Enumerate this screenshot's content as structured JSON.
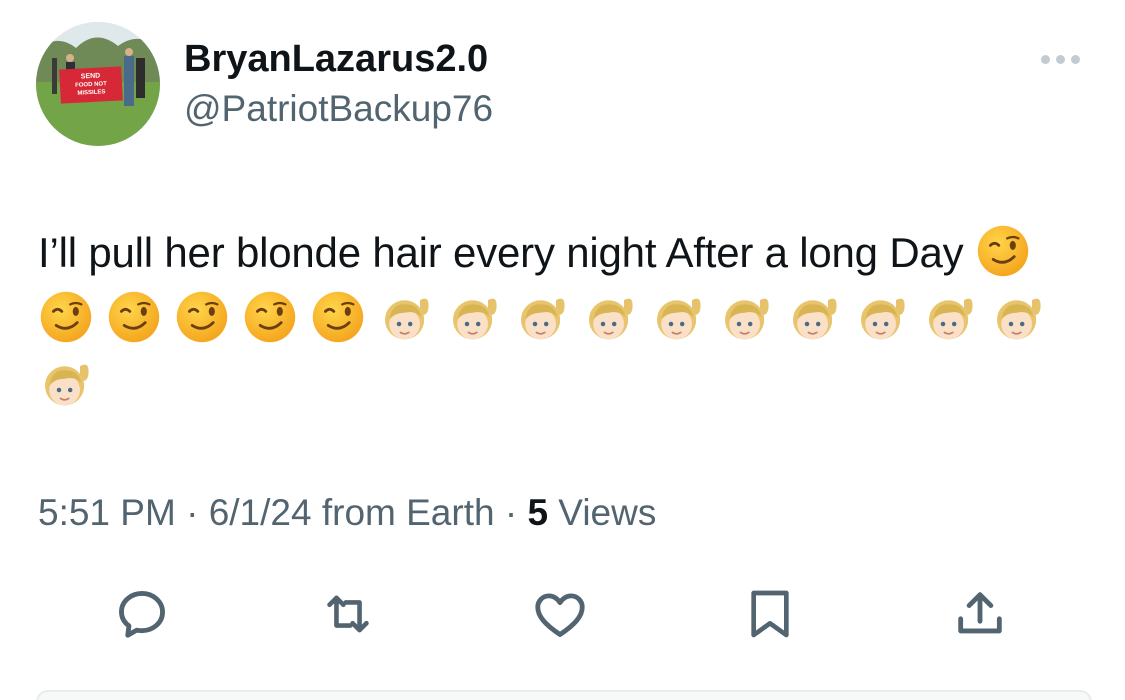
{
  "author": {
    "display_name": "BryanLazarus2.0",
    "handle": "@PatriotBackup76",
    "avatar_sign_text": [
      "SEND",
      "FOOD NOT",
      "MISSILES"
    ]
  },
  "more_menu": {
    "icon": "more-horizontal-icon"
  },
  "tweet": {
    "text": "I’ll pull her blonde hair every night After a long Day",
    "emojis": {
      "wink_count": 6,
      "blonde_woman_count": 11
    }
  },
  "meta": {
    "time": "5:51 PM",
    "sep1": " · ",
    "date": "6/1/24",
    "source": " from Earth",
    "sep2": " · ",
    "views_count": "5",
    "views_label": " Views"
  },
  "actions": [
    {
      "name": "reply",
      "icon": "reply-icon"
    },
    {
      "name": "retweet",
      "icon": "retweet-icon"
    },
    {
      "name": "like",
      "icon": "heart-icon"
    },
    {
      "name": "bookmark",
      "icon": "bookmark-icon"
    },
    {
      "name": "share",
      "icon": "share-icon"
    }
  ],
  "colors": {
    "text": "#0f1419",
    "secondary": "#536471",
    "icon": "#536471"
  }
}
